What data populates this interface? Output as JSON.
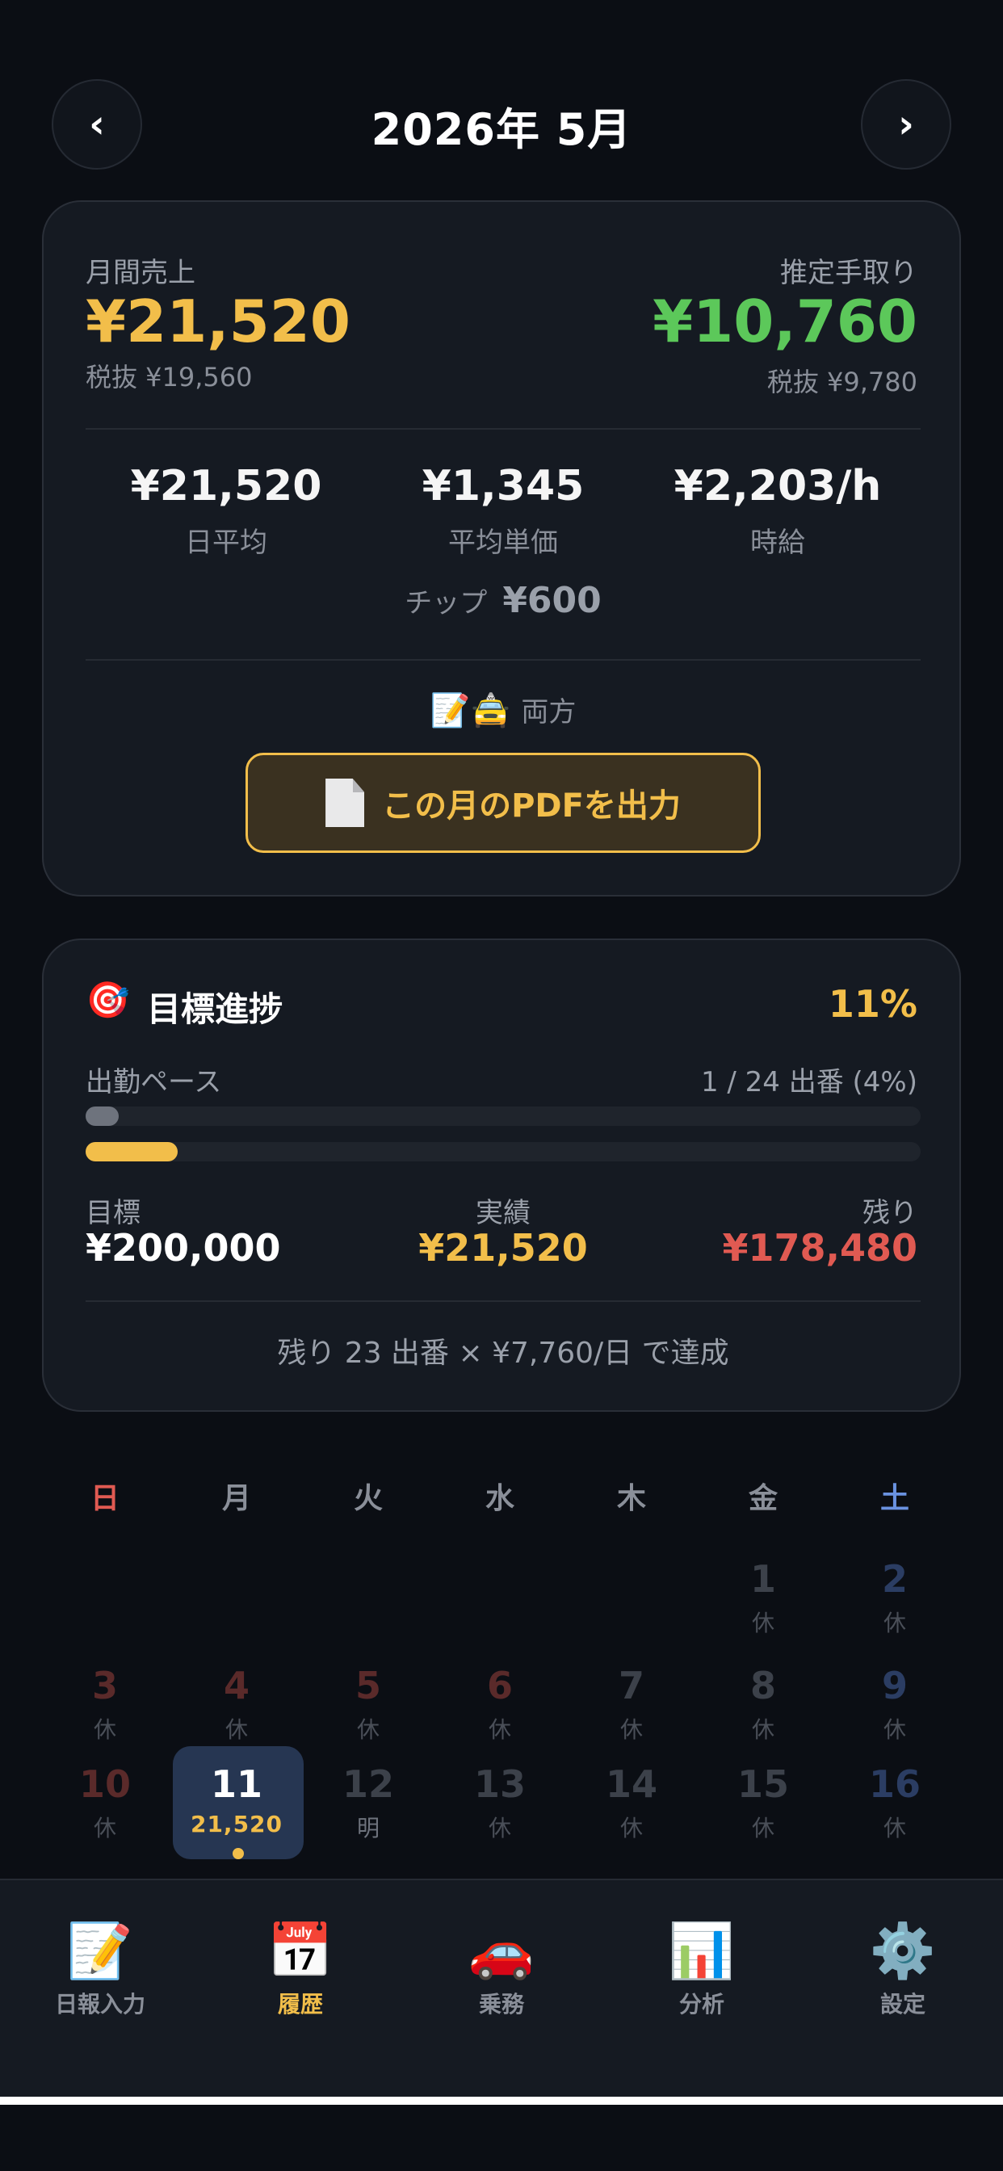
{
  "header": {
    "title": "2026年 5月",
    "prev": "‹",
    "next": "›"
  },
  "summary": {
    "sales_label": "月間売上",
    "sales_value": "¥21,520",
    "sales_tax_excl": "税抜 ¥19,560",
    "net_label": "推定手取り",
    "net_value": "¥10,760",
    "net_tax_excl": "税抜 ¥9,780",
    "stats": [
      {
        "value": "¥21,520",
        "label": "日平均"
      },
      {
        "value": "¥1,345",
        "label": "平均単価"
      },
      {
        "value": "¥2,203/h",
        "label": "時給"
      }
    ],
    "tip_label": "チップ",
    "tip_value": "¥600",
    "mode_icons": "📝🚖",
    "mode_label": "両方",
    "pdf_button": "この月のPDFを出力"
  },
  "goal": {
    "icon": "🎯",
    "title": "目標進捗",
    "percent": "11%",
    "pace_label": "出勤ペース",
    "pace_value": "1 / 24 出番 (4%)",
    "pace_fraction": 0.04,
    "sales_fraction": 0.11,
    "target_label": "目標",
    "target_value": "¥200,000",
    "actual_label": "実績",
    "actual_value": "¥21,520",
    "remaining_label": "残り",
    "remaining_value": "¥178,480",
    "footer": "残り 23 出番 × ¥7,760/日 で達成"
  },
  "calendar": {
    "weekdays": [
      "日",
      "月",
      "火",
      "水",
      "木",
      "金",
      "土"
    ],
    "week1": [
      {
        "num": "1",
        "status": "休"
      },
      {
        "num": "2",
        "status": "休"
      }
    ],
    "week2": [
      {
        "num": "3",
        "status": "休"
      },
      {
        "num": "4",
        "status": "休"
      },
      {
        "num": "5",
        "status": "休"
      },
      {
        "num": "6",
        "status": "休"
      },
      {
        "num": "7",
        "status": "休"
      },
      {
        "num": "8",
        "status": "休"
      },
      {
        "num": "9",
        "status": "休"
      }
    ],
    "week3": [
      {
        "num": "10",
        "status": "休"
      },
      {
        "num": "11",
        "status": "21,520"
      },
      {
        "num": "12",
        "status": "明"
      },
      {
        "num": "13",
        "status": "休"
      },
      {
        "num": "14",
        "status": "休"
      },
      {
        "num": "15",
        "status": "休"
      },
      {
        "num": "16",
        "status": "休"
      }
    ]
  },
  "tabs": [
    {
      "icon": "📝",
      "label": "日報入力"
    },
    {
      "icon": "📅",
      "label": "履歴"
    },
    {
      "icon": "🚗",
      "label": "乗務"
    },
    {
      "icon": "📊",
      "label": "分析"
    },
    {
      "icon": "⚙️",
      "label": "設定"
    }
  ],
  "colors": {
    "accent": "#f2be4a",
    "green": "#5cc85a",
    "red": "#e05a52",
    "sunday": "#e05a52",
    "saturday": "#6a92e0"
  }
}
